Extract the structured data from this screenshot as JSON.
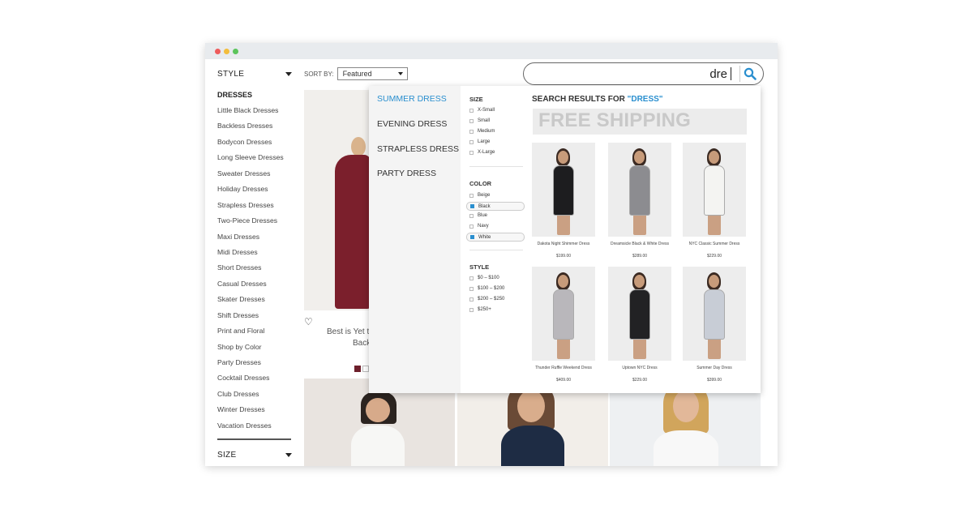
{
  "sidebar": {
    "style_label": "STYLE",
    "category": "DRESSES",
    "items": [
      "Little Black Dresses",
      "Backless Dresses",
      "Bodycon Dresses",
      "Long Sleeve Dresses",
      "Sweater Dresses",
      "Holiday Dresses",
      "Strapless Dresses",
      "Two-Piece Dresses",
      "Maxi Dresses",
      "Midi Dresses",
      "Short Dresses",
      "Casual Dresses",
      "Skater Dresses",
      "Shift Dresses",
      "Print and Floral",
      "Shop by Color",
      "Party Dresses",
      "Cocktail Dresses",
      "Club Dresses",
      "Winter Dresses",
      "Vacation Dresses"
    ],
    "size_label": "SIZE"
  },
  "sort": {
    "label": "SORT BY:",
    "value": "Featured"
  },
  "search": {
    "value": "dre"
  },
  "background": {
    "text1": "Best is Yet t",
    "text2": "Back"
  },
  "suggestions": [
    "SUMMER DRESS",
    "EVENING DRESS",
    "STRAPLESS DRESS",
    "PARTY DRESS"
  ],
  "filters": {
    "size": {
      "title": "SIZE",
      "options": [
        "X-Small",
        "Small",
        "Medium",
        "Large",
        "X-Large"
      ]
    },
    "color": {
      "title": "COLOR",
      "options": [
        "Beige",
        "Black",
        "Blue",
        "Navy",
        "White"
      ],
      "selected": [
        "Black",
        "White"
      ]
    },
    "style": {
      "title": "STYLE",
      "options": [
        "$0 – $100",
        "$100 – $200",
        "$200 – $250",
        "$250+"
      ]
    }
  },
  "results": {
    "title_prefix": "SEARCH RESULTS FOR ",
    "query": "\"DRESS\"",
    "banner": "FREE SHIPPING",
    "products": [
      {
        "name": "Dakota Night Shimmer Dress",
        "price": "$199.00",
        "color": "#1d1d1f"
      },
      {
        "name": "Dreamsicle Black & White Dress",
        "price": "$289.00",
        "color": "#8c8c90"
      },
      {
        "name": "NYC Classic Summer Dress",
        "price": "$229.00",
        "color": "#f4f4f2"
      },
      {
        "name": "Thunder Ruffle Weekend Dress",
        "price": "$409.00",
        "color": "#b9b7bb"
      },
      {
        "name": "Uptown NYC Dress",
        "price": "$229.00",
        "color": "#222224"
      },
      {
        "name": "Summer Day Dress",
        "price": "$399.00",
        "color": "#c8cdd6"
      }
    ]
  },
  "colors": {
    "accent": "#2a8fcf"
  }
}
